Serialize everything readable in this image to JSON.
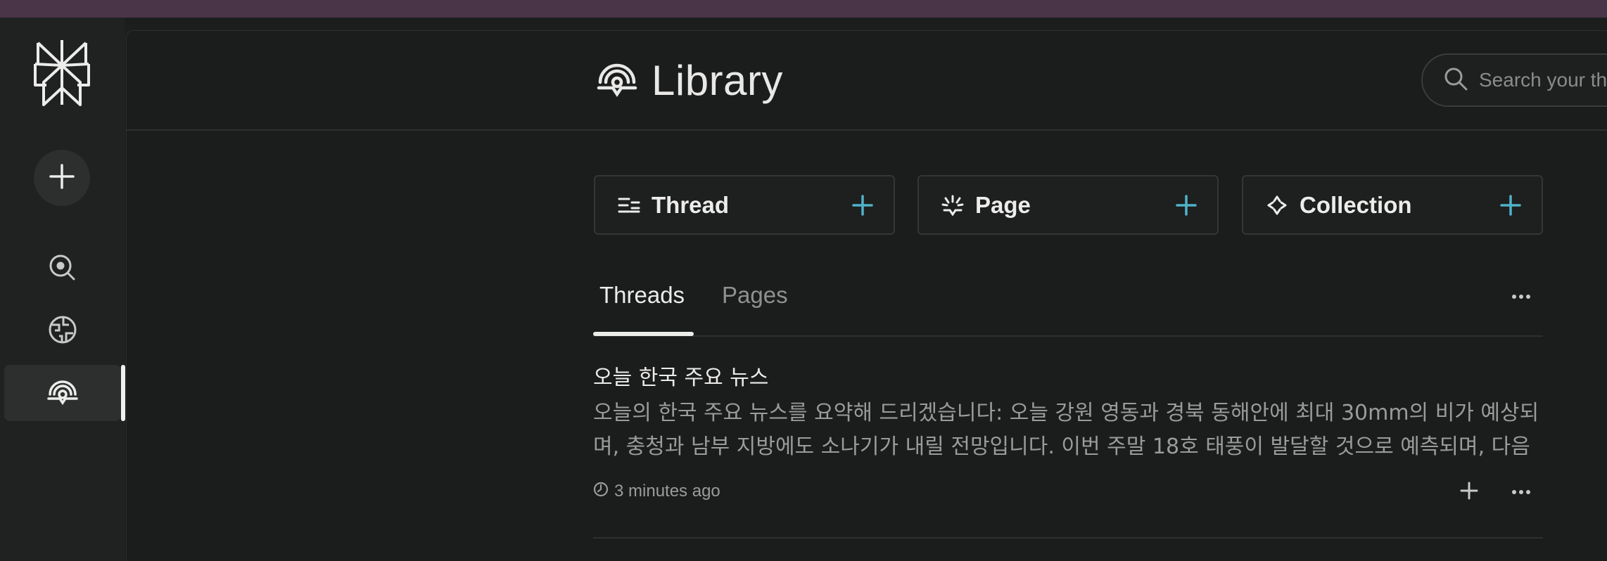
{
  "sidebar": {
    "logo": "perplexity-logo",
    "new_button_icon": "plus-icon",
    "items": [
      {
        "name": "discover",
        "icon": "search-discover-icon"
      },
      {
        "name": "spaces",
        "icon": "globe-icon"
      },
      {
        "name": "library",
        "icon": "library-icon",
        "active": true
      }
    ]
  },
  "header": {
    "title": "Library",
    "title_icon": "library-icon",
    "search_placeholder": "Search your threads..."
  },
  "create_cards": [
    {
      "label": "Thread",
      "icon": "thread-icon"
    },
    {
      "label": "Page",
      "icon": "page-icon"
    },
    {
      "label": "Collection",
      "icon": "collection-icon"
    }
  ],
  "tabs": [
    {
      "label": "Threads",
      "active": true
    },
    {
      "label": "Pages",
      "active": false
    }
  ],
  "threads": [
    {
      "title": "오늘 한국 주요 뉴스",
      "snippet": "오늘의 한국 주요 뉴스를 요약해 드리겠습니다: 오늘 강원 영동과 경북 동해안에 최대 30mm의 비가 예상되며, 충청과 남부 지방에도 소나기가 내릴 전망입니다. 이번 주말 18호 태풍이 발달할 것으로 예측되며, 다음 ...",
      "time": "3 minutes ago"
    }
  ],
  "colors": {
    "accent": "#4fb3c9",
    "topbar": "#4a3548",
    "background": "#1c1d1d"
  }
}
